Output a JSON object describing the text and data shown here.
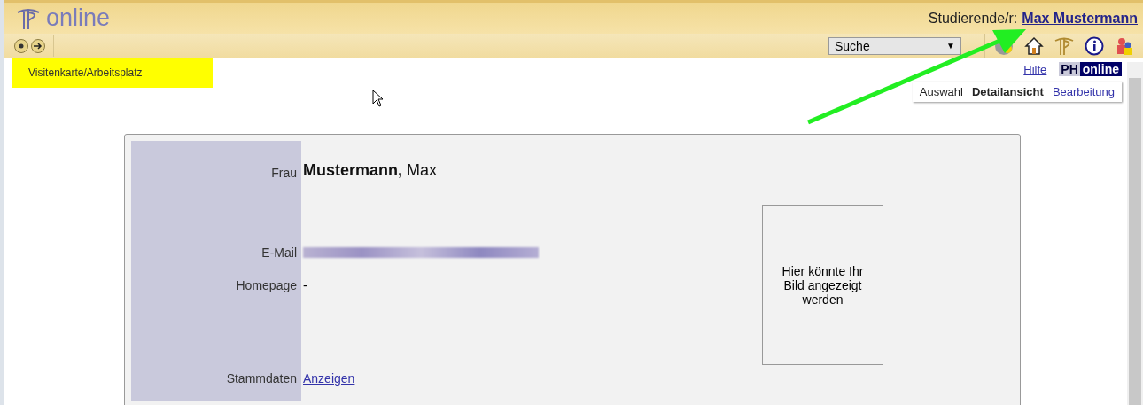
{
  "header": {
    "logo_text": "online",
    "role_label": "Studierende/r:",
    "user_link": "Max Mustermann"
  },
  "toolbar": {
    "search_select": {
      "value": "Suche",
      "caret": "▼"
    }
  },
  "tabs": [
    {
      "label": "Visitenkarte/Arbeitsplatz",
      "selected": true
    }
  ],
  "top_links": {
    "help": "Hilfe",
    "brand_left": "PH",
    "brand_right": "online"
  },
  "views": [
    {
      "label": "Auswahl",
      "selected": false,
      "kind": "text"
    },
    {
      "label": "Detailansicht",
      "selected": true,
      "kind": "text"
    },
    {
      "label": "Bearbeitung",
      "selected": false,
      "kind": "link"
    }
  ],
  "card": {
    "salutation": "Frau",
    "last_name": "Mustermann,",
    "first_name": "Max",
    "email": {
      "label": "E-Mail",
      "redacted": true
    },
    "fields": [
      {
        "label": "Homepage",
        "kind": "text",
        "value": "-"
      },
      {
        "label": "Stammdaten",
        "kind": "link",
        "value": "Anzeigen"
      }
    ],
    "photo_text": "Hier könnte Ihr Bild angezeigt werden"
  }
}
